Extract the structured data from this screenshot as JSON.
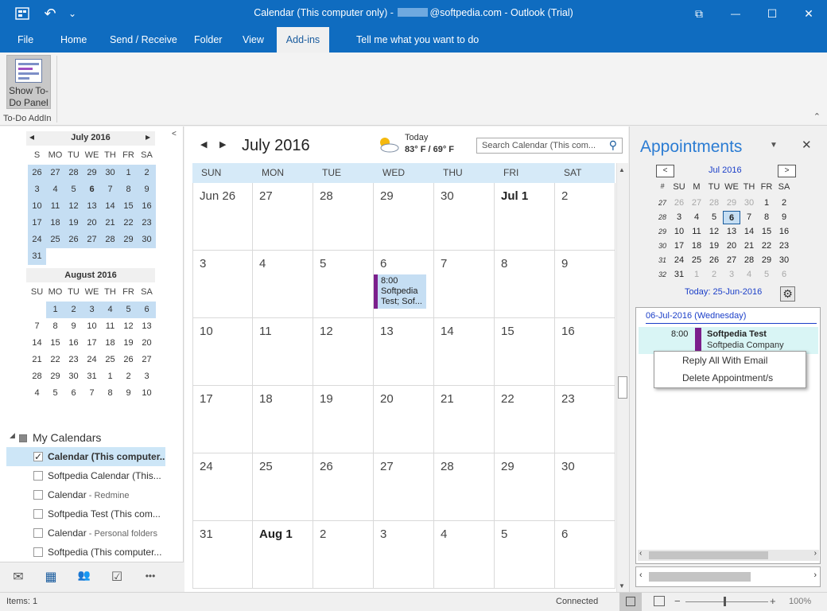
{
  "window": {
    "title_prefix": "Calendar (This computer only) - ",
    "title_suffix": "@softpedia.com - Outlook (Trial)",
    "undo": "↶",
    "quick": "⌄",
    "restore": "⧉",
    "minimize": "—",
    "maximize": "☐",
    "close": "✕"
  },
  "tabs": [
    "File",
    "Home",
    "Send / Receive",
    "Folder",
    "View",
    "Add-ins",
    "Tell me what you want to do"
  ],
  "ribbon": {
    "button_line1": "Show To-",
    "button_line2": "Do Panel",
    "group": "To-Do AddIn",
    "collapse": "⌃"
  },
  "mini_july": {
    "header": "July 2016",
    "prev": "◂",
    "next": "▸",
    "dow": [
      "S",
      "MO",
      "TU",
      "WE",
      "TH",
      "FR",
      "SA"
    ],
    "days": [
      "26",
      "27",
      "28",
      "29",
      "30",
      "1",
      "2",
      "3",
      "4",
      "5",
      "6",
      "7",
      "8",
      "9",
      "10",
      "11",
      "12",
      "13",
      "14",
      "15",
      "16",
      "17",
      "18",
      "19",
      "20",
      "21",
      "22",
      "23",
      "24",
      "25",
      "26",
      "27",
      "28",
      "29",
      "30",
      "31"
    ]
  },
  "mini_august": {
    "header": "August 2016",
    "dow": [
      "SU",
      "MO",
      "TU",
      "WE",
      "TH",
      "FR",
      "SA"
    ],
    "days": [
      "1",
      "2",
      "3",
      "4",
      "5",
      "6",
      "7",
      "8",
      "9",
      "10",
      "11",
      "12",
      "13",
      "14",
      "15",
      "16",
      "17",
      "18",
      "19",
      "20",
      "21",
      "22",
      "23",
      "24",
      "25",
      "26",
      "27",
      "28",
      "29",
      "30",
      "31",
      "1",
      "2",
      "3",
      "4",
      "5",
      "6",
      "7",
      "8",
      "9",
      "10"
    ]
  },
  "my_calendars": {
    "toggle": "◢",
    "label": "My Calendars",
    "items": [
      {
        "label": "Calendar (This computer...",
        "sub": "",
        "checked": "✓"
      },
      {
        "label": "Softpedia Calendar (This...",
        "sub": "",
        "checked": ""
      },
      {
        "label": "Calendar",
        "sub": " - Redmine",
        "checked": ""
      },
      {
        "label": "Softpedia Test (This com...",
        "sub": "",
        "checked": ""
      },
      {
        "label": "Calendar",
        "sub": " - Personal folders",
        "checked": ""
      },
      {
        "label": "Softpedia (This computer...",
        "sub": "",
        "checked": ""
      }
    ]
  },
  "nav_icons": {
    "mail": "✉",
    "calendar": "▦",
    "people": "👥",
    "tasks": "☑",
    "more": "•••"
  },
  "calendar": {
    "prev": "◀",
    "next": "▶",
    "month": "July 2016",
    "weather_label": "Today",
    "weather_temp": "83° F / 69° F",
    "search_placeholder": "Search Calendar (This com...",
    "search_icon": "⚲",
    "weekdays": [
      "SUN",
      "MON",
      "TUE",
      "WED",
      "THU",
      "FRI",
      "SAT"
    ],
    "weeks": [
      [
        "Jun 26",
        "27",
        "28",
        "29",
        "30",
        "Jul 1",
        "2"
      ],
      [
        "3",
        "4",
        "5",
        "6",
        "7",
        "8",
        "9"
      ],
      [
        "10",
        "11",
        "12",
        "13",
        "14",
        "15",
        "16"
      ],
      [
        "17",
        "18",
        "19",
        "20",
        "21",
        "22",
        "23"
      ],
      [
        "24",
        "25",
        "26",
        "27",
        "28",
        "29",
        "30"
      ],
      [
        "31",
        "Aug 1",
        "2",
        "3",
        "4",
        "5",
        "6"
      ]
    ],
    "event_time": "8:00",
    "event_text": "Softpedia Test; Sof..."
  },
  "appointments": {
    "title": "Appointments",
    "dropdown": "▼",
    "close": "✕",
    "prev": "<",
    "next": ">",
    "month": "Jul 2016",
    "dow": [
      "#",
      "SU",
      "M",
      "TU",
      "WE",
      "TH",
      "FR",
      "SA"
    ],
    "weeks": [
      [
        "27",
        "26",
        "27",
        "28",
        "29",
        "30",
        "1",
        "2"
      ],
      [
        "28",
        "3",
        "4",
        "5",
        "6",
        "7",
        "8",
        "9"
      ],
      [
        "29",
        "10",
        "11",
        "12",
        "13",
        "14",
        "15",
        "16"
      ],
      [
        "30",
        "17",
        "18",
        "19",
        "20",
        "21",
        "22",
        "23"
      ],
      [
        "31",
        "24",
        "25",
        "26",
        "27",
        "28",
        "29",
        "30"
      ],
      [
        "32",
        "31",
        "1",
        "2",
        "3",
        "4",
        "5",
        "6"
      ]
    ],
    "today": "Today: 25-Jun-2016",
    "gear": "⚙",
    "date_header": "06-Jul-2016 (Wednesday)",
    "appt_time": "8:00",
    "appt_title": "Softpedia Test",
    "appt_company": "Softpedia Company"
  },
  "context_menu": {
    "item1": "Reply All With Email",
    "item2": "Delete Appointment/s"
  },
  "status": {
    "items": "Items: 1",
    "connected": "Connected",
    "zoom": "100%"
  }
}
